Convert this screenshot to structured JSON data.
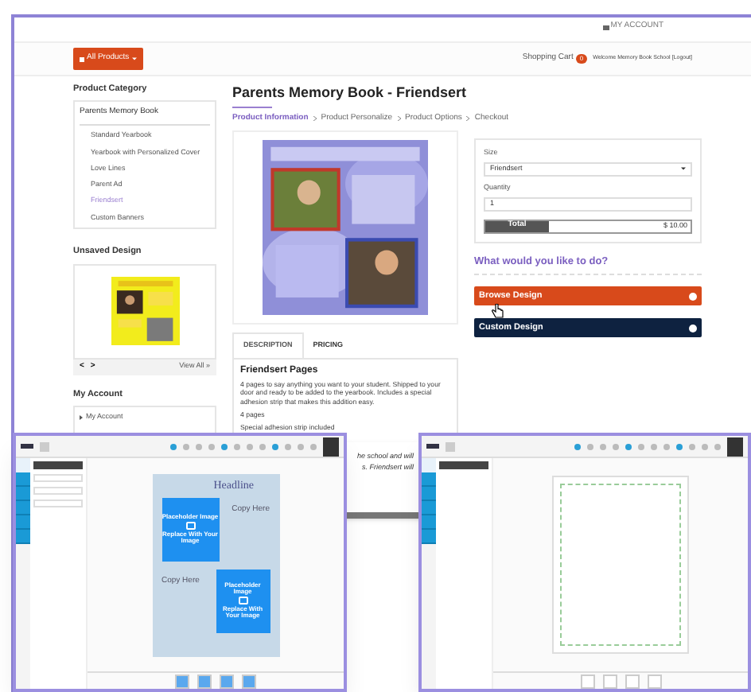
{
  "header": {
    "account_link": "MY ACCOUNT"
  },
  "nav": {
    "products_button": "All Products",
    "cart_label": "Shopping Cart",
    "cart_count": "0",
    "welcome": "Welcome Memory Book School",
    "logout": "[Logout]"
  },
  "sidebar": {
    "category_title": "Product Category",
    "category_heading": "Parents Memory Book",
    "items": [
      {
        "label": "Standard Yearbook",
        "selected": false
      },
      {
        "label": "Yearbook with Personalized Cover",
        "selected": false
      },
      {
        "label": "Love Lines",
        "selected": false
      },
      {
        "label": "Parent Ad",
        "selected": false
      },
      {
        "label": "Friendsert",
        "selected": true
      },
      {
        "label": "Custom Banners",
        "selected": false
      }
    ],
    "unsaved_title": "Unsaved Design",
    "prev": "<",
    "next": ">",
    "view_all": "View All »",
    "account_title": "My Account",
    "account_items": [
      "My Account"
    ]
  },
  "product": {
    "title": "Parents Memory Book - Friendsert",
    "breadcrumb": [
      {
        "label": "Product Information",
        "selected": true
      },
      {
        "label": "Product Personalize",
        "selected": false
      },
      {
        "label": "Product Options",
        "selected": false
      },
      {
        "label": "Checkout",
        "selected": false
      }
    ],
    "tabs": [
      {
        "label": "DESCRIPTION",
        "selected": true
      },
      {
        "label": "PRICING",
        "selected": false
      }
    ],
    "description_title": "Friendsert Pages",
    "description": "4 pages to say anything you want to your student. Shipped to your door and ready to be added to the yearbook. Includes a special adhesion strip that makes this addition easy.",
    "details": [
      "4 pages",
      "Special adhesion strip included"
    ]
  },
  "options": {
    "size_label": "Size",
    "size_value": "Friendsert",
    "quantity_label": "Quantity",
    "quantity_value": "1",
    "total_label": "Total",
    "total_value": "$ 10.00",
    "question": "What would you like to do?",
    "actions": [
      {
        "label": "Browse Design",
        "kind": "primary"
      },
      {
        "label": "Custom Design",
        "kind": "secondary"
      }
    ]
  },
  "behind_window": {
    "lines": [
      "he school and will",
      "s. Friendsert will"
    ]
  },
  "editors": [
    {
      "kind": "template",
      "headline": "Headline",
      "copy": [
        "Copy Here",
        "Copy Here"
      ],
      "placeholders": [
        {
          "title": "Placeholder Image",
          "action": "Replace With Your Image"
        },
        {
          "title": "Placeholder Image",
          "action": "Replace With Your Image"
        }
      ]
    },
    {
      "kind": "blank"
    }
  ]
}
